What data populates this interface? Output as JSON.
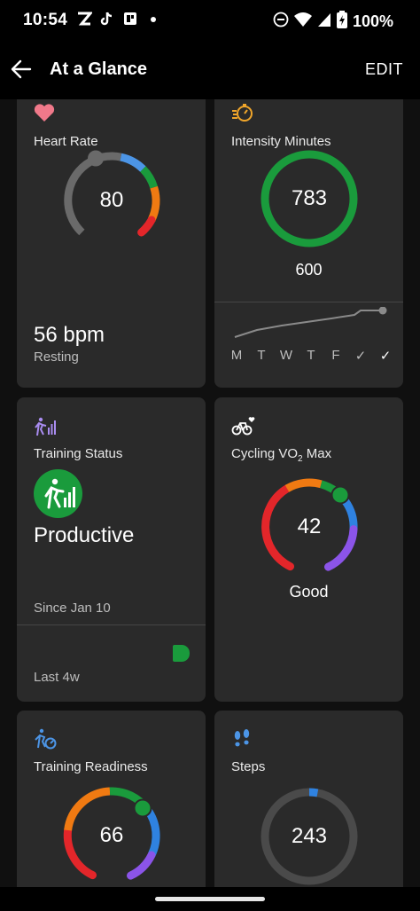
{
  "status_bar": {
    "time": "10:54",
    "battery": "100%"
  },
  "app_bar": {
    "title": "At a Glance",
    "edit": "EDIT"
  },
  "cards": {
    "heart_rate": {
      "label": "Heart Rate",
      "gauge_value": "80",
      "value": "56 bpm",
      "sub_label": "Resting"
    },
    "intensity_minutes": {
      "label": "Intensity Minutes",
      "ring_value": "783",
      "goal": "600",
      "days": [
        "M",
        "T",
        "W",
        "T",
        "F",
        "✓",
        "✓"
      ]
    },
    "training_status": {
      "label": "Training Status",
      "status": "Productive",
      "since": "Since Jan 10",
      "period": "Last 4w"
    },
    "cycling_vo2": {
      "label_prefix": "Cycling VO",
      "label_sub": "2",
      "label_suffix": " Max",
      "gauge_value": "42",
      "rating": "Good"
    },
    "training_readiness": {
      "label": "Training Readiness",
      "gauge_value": "66"
    },
    "steps": {
      "label": "Steps",
      "ring_value": "243"
    }
  },
  "colors": {
    "background": "#101010",
    "card": "#2a2a2a",
    "green": "#1a9b3c",
    "orange": "#f07a12",
    "red": "#e3262a",
    "blue": "#2f82e0",
    "purple": "#8b54e8",
    "gray": "#6a6a6a",
    "heart": "#f0798a"
  },
  "icons": {
    "heart_rate": "heart-icon",
    "intensity": "stopwatch-icon",
    "training_status": "runner-bars-icon",
    "cycling": "bike-heart-icon",
    "readiness": "runner-gauge-icon",
    "steps": "footprints-icon"
  }
}
